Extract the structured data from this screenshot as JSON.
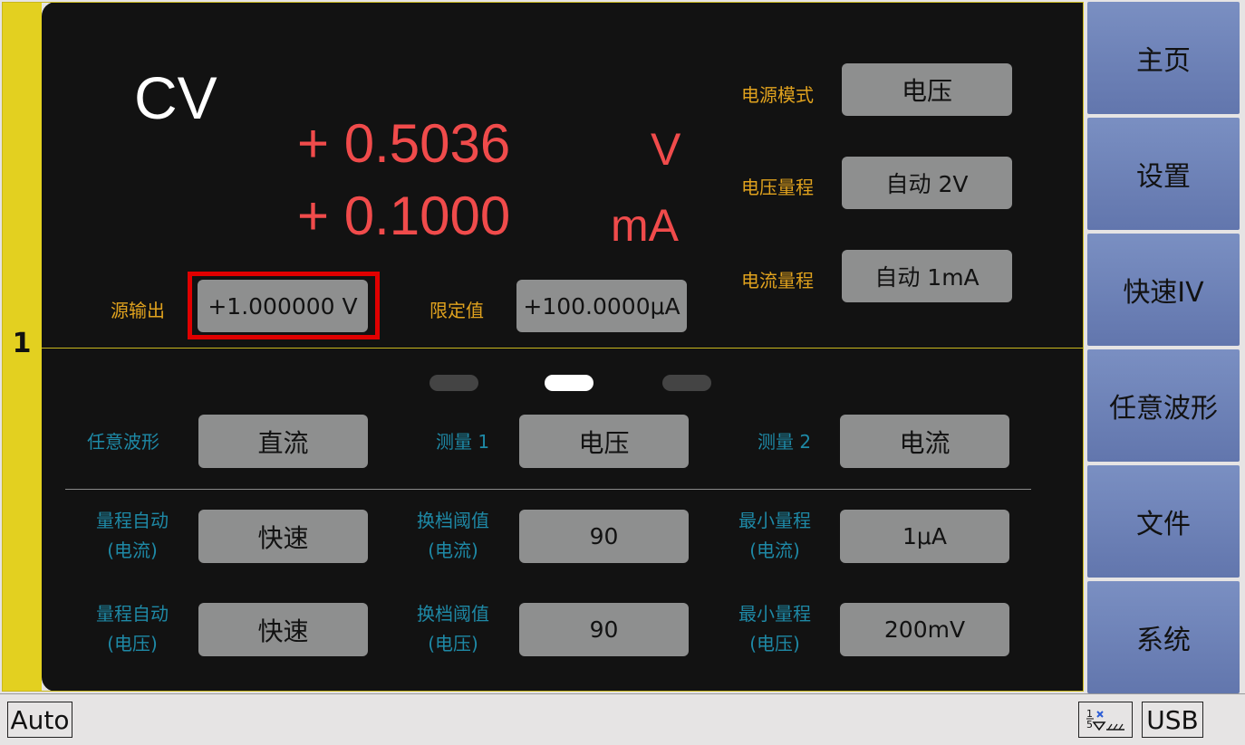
{
  "channel": "1",
  "mode": "CV",
  "readings": {
    "voltage_value": "+ 0.5036",
    "voltage_unit": "V",
    "current_value": "+ 0.1000",
    "current_unit": "mA"
  },
  "source": {
    "output_label": "源输出",
    "output_value": "+1.000000 V",
    "limit_label": "限定值",
    "limit_value": "+100.0000μA"
  },
  "settings": {
    "power_mode_label": "电源模式",
    "power_mode_value": "电压",
    "voltage_range_label": "电压量程",
    "voltage_range_value": "自动 2V",
    "current_range_label": "电流量程",
    "current_range_value": "自动 1mA"
  },
  "page_indicator": {
    "count": 3,
    "active": 2
  },
  "measure": {
    "waveform_label": "任意波形",
    "waveform_value": "直流",
    "measure1_label": "测量 1",
    "measure1_value": "电压",
    "measure2_label": "测量 2",
    "measure2_value": "电流"
  },
  "range_current": {
    "auto_label_1": "量程自动",
    "auto_label_2": "(电流)",
    "auto_value": "快速",
    "threshold_label_1": "换档阈值",
    "threshold_label_2": "(电流)",
    "threshold_value": "90",
    "min_label_1": "最小量程",
    "min_label_2": "(电流)",
    "min_value": "1μA"
  },
  "range_voltage": {
    "auto_label_1": "量程自动",
    "auto_label_2": "(电压)",
    "auto_value": "快速",
    "threshold_label_1": "换档阈值",
    "threshold_label_2": "(电压)",
    "threshold_value": "90",
    "min_label_1": "最小量程",
    "min_label_2": "(电压)",
    "min_value": "200mV"
  },
  "sidebar": [
    "主页",
    "设置",
    "快速IV",
    "任意波形",
    "文件",
    "系统"
  ],
  "status": {
    "mode": "Auto",
    "usb": "USB",
    "icon": "trigger-icon"
  },
  "colors": {
    "accent_yellow": "#e3d020",
    "reading_red": "#f04b4b",
    "label_orange": "#e0a21e",
    "label_blue": "#1e89a6",
    "side_button": "#6e82b8"
  }
}
